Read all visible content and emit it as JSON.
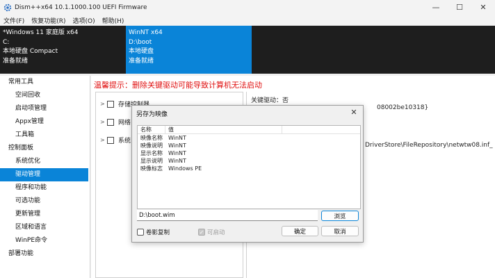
{
  "window": {
    "title": "Dism++x64 10.1.1000.100 UEFI Firmware",
    "controls": [
      "—",
      "☐",
      "✕"
    ]
  },
  "menu": [
    "文件(F)",
    "恢复功能(R)",
    "选项(O)",
    "帮助(H)"
  ],
  "systems": [
    {
      "lines": [
        "*Windows 11 家庭版 x64",
        "C:",
        "本地硬盘 Compact",
        "准备就绪"
      ]
    },
    {
      "lines": [
        "WinNT x64",
        "D:\\boot",
        "本地硬盘",
        "准备就绪"
      ]
    }
  ],
  "sidebar": {
    "groups": [
      {
        "label": "常用工具",
        "items": [
          "空间回收",
          "启动项管理",
          "Appx管理",
          "工具箱"
        ]
      },
      {
        "label": "控制面板",
        "items": [
          "系统优化",
          "驱动管理",
          "程序和功能",
          "可选功能",
          "更新管理",
          "区域和语言",
          "WinPE命令"
        ]
      },
      {
        "label": "部署功能",
        "items": []
      }
    ],
    "active": "驱动管理"
  },
  "main": {
    "warning": "温馨提示：删除关键驱动可能导致计算机无法启动",
    "tree": [
      "存储控制器",
      "网络",
      "系统"
    ],
    "detail": [
      "关键驱动：否",
      "08002be10318}",
      "DriverStore\\FileRepository\\netwtw08.inf_"
    ]
  },
  "dialog": {
    "title": "另存为映像",
    "close": "✕",
    "columns": [
      "名称",
      "值",
      ""
    ],
    "rows": [
      [
        "映像名称",
        "WinNT"
      ],
      [
        "映像说明",
        "WinNT"
      ],
      [
        "显示名称",
        "WinNT"
      ],
      [
        "显示说明",
        "WinNT"
      ],
      [
        "映像标志",
        "Windows PE"
      ]
    ],
    "path_value": "D:\\boot.wim",
    "browse_label": "浏览",
    "ok_label": "确定",
    "cancel_label": "取消",
    "checkbox_volume": "卷影复制",
    "checkbox_bootable": "可启动"
  },
  "colors": {
    "accent": "#0a84d8",
    "warning": "#e01010",
    "dark": "#1e1e1e"
  }
}
